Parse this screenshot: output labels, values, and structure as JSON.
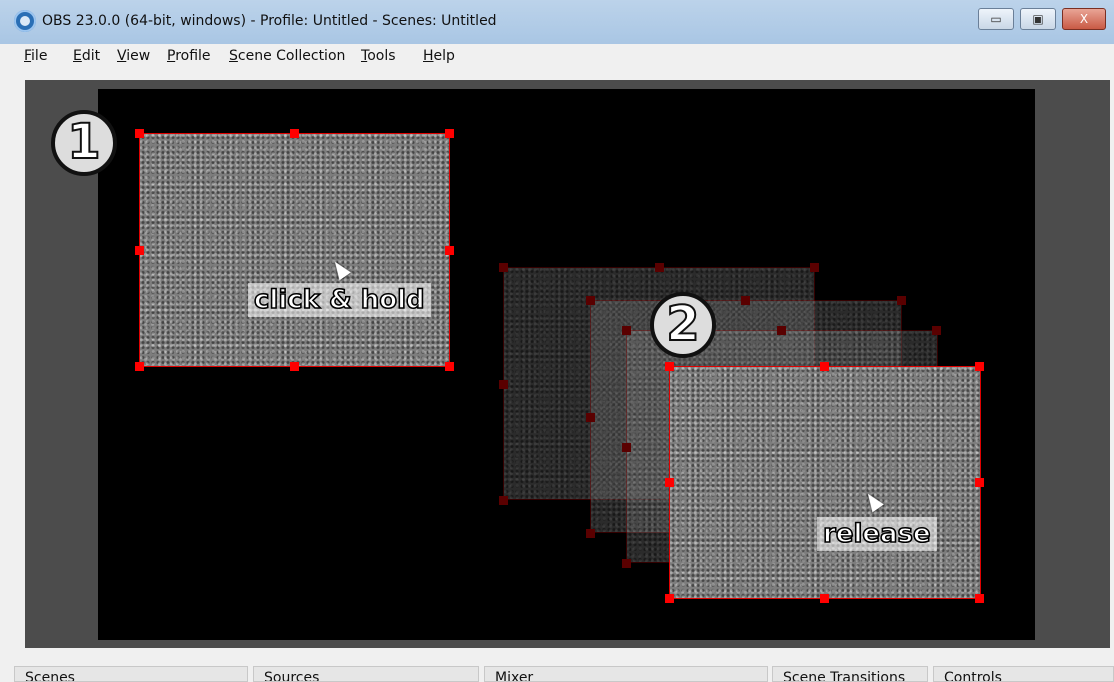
{
  "window": {
    "title": "OBS 23.0.0 (64-bit, windows) - Profile: Untitled - Scenes: Untitled",
    "buttons": {
      "minimize": "▭",
      "maximize": "▣",
      "close": "X"
    }
  },
  "menu": [
    "File",
    "Edit",
    "View",
    "Profile",
    "Scene Collection",
    "Tools",
    "Help"
  ],
  "preview": {
    "step1": {
      "number": "1",
      "label": "click & hold"
    },
    "step2": {
      "number": "2",
      "label": "release"
    }
  },
  "docks": [
    "Scenes",
    "Sources",
    "Mixer",
    "Scene Transitions",
    "Controls"
  ],
  "colors": {
    "selection": "#ff0000",
    "preview_bg": "#4c4c4c",
    "canvas": "#000000"
  }
}
